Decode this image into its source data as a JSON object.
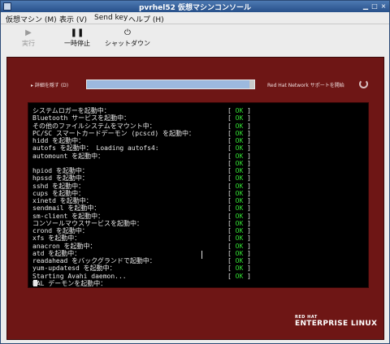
{
  "window": {
    "title": "pvrhel52 仮想マシンコンソール"
  },
  "menubar": [
    {
      "label": "仮想マシン (M)"
    },
    {
      "label": "表示 (V)"
    },
    {
      "label": "Send key"
    },
    {
      "label": "ヘルプ (H)"
    }
  ],
  "toolbar": {
    "run_label": "実行",
    "pause_label": "一時停止",
    "shutdown_label": "シャットダウン"
  },
  "boot": {
    "details_toggle": "詳細を隠す (D)",
    "progress": 0.97,
    "status_message": "Red Hat Network サポートを開始"
  },
  "console": {
    "lines": [
      {
        "text": "システムロガーを起動中：",
        "status_open": "[",
        "status": "OK",
        "status_close": "]"
      },
      {
        "text": "Bluetooth サービスを起動中：",
        "status_open": "[",
        "status": "OK",
        "status_close": "]"
      },
      {
        "text": "その他のファイルシステムをマウント中：",
        "status_open": "[",
        "status": "OK",
        "status_close": "]"
      },
      {
        "text": "PC/SC スマートカードデーモン (pcscd) を起動中：",
        "status_open": "[",
        "status": "OK",
        "status_close": "]"
      },
      {
        "text": "hidd を起動中：",
        "status_open": "[",
        "status": "OK",
        "status_close": "]"
      },
      {
        "text": "autofs を起動中：  Loading autofs4:",
        "status_open": "[",
        "status": "OK",
        "status_close": "]"
      },
      {
        "text": "automount を起動中：",
        "status_open": "[",
        "status": "OK",
        "status_close": "]"
      },
      {
        "text": "",
        "status_open": "[",
        "status": "OK",
        "status_close": "]"
      },
      {
        "text": "hpiod を起動中：",
        "status_open": "[",
        "status": "OK",
        "status_close": "]"
      },
      {
        "text": "hpssd を起動中：",
        "status_open": "[",
        "status": "OK",
        "status_close": "]"
      },
      {
        "text": "sshd を起動中：",
        "status_open": "[",
        "status": "OK",
        "status_close": "]"
      },
      {
        "text": "cups を起動中：",
        "status_open": "[",
        "status": "OK",
        "status_close": "]"
      },
      {
        "text": "xinetd を起動中：",
        "status_open": "[",
        "status": "OK",
        "status_close": "]"
      },
      {
        "text": "sendmail を起動中：",
        "status_open": "[",
        "status": "OK",
        "status_close": "]"
      },
      {
        "text": "sm-client を起動中：",
        "status_open": "[",
        "status": "OK",
        "status_close": "]"
      },
      {
        "text": "コンソールマウスサービスを起動中：",
        "status_open": "[",
        "status": "OK",
        "status_close": "]"
      },
      {
        "text": "crond を起動中：",
        "status_open": "[",
        "status": "OK",
        "status_close": "]"
      },
      {
        "text": "xfs を起動中：",
        "status_open": "[",
        "status": "OK",
        "status_close": "]"
      },
      {
        "text": "anacron を起動中：",
        "status_open": "[",
        "status": "OK",
        "status_close": "]"
      },
      {
        "text": "atd を起動中：",
        "status_open": "[",
        "status": "OK",
        "status_close": "]"
      },
      {
        "text": "readahead をバックグランドで起動中：",
        "status_open": "[",
        "status": "OK",
        "status_close": "]"
      },
      {
        "text": "yum-updatesd を起動中：",
        "status_open": "[",
        "status": "OK",
        "status_close": "]"
      },
      {
        "text": "Starting Avahi daemon...",
        "status_open": "[",
        "status": "OK",
        "status_close": "]"
      },
      {
        "text": "HAL デーモンを起動中：",
        "status_open": "",
        "status": "",
        "status_close": ""
      }
    ]
  },
  "logo": {
    "line1": "RED HAT",
    "line2": "ENTERPRISE LINUX"
  },
  "icons": {
    "run": "play-icon",
    "pause": "pause-icon",
    "shutdown": "power-icon",
    "spinner": "spinner-icon"
  },
  "colors": {
    "stage_background": "#6e1615",
    "console_background": "#000000",
    "ok_color": "#33e033",
    "titlebar": "#3a66a0"
  }
}
